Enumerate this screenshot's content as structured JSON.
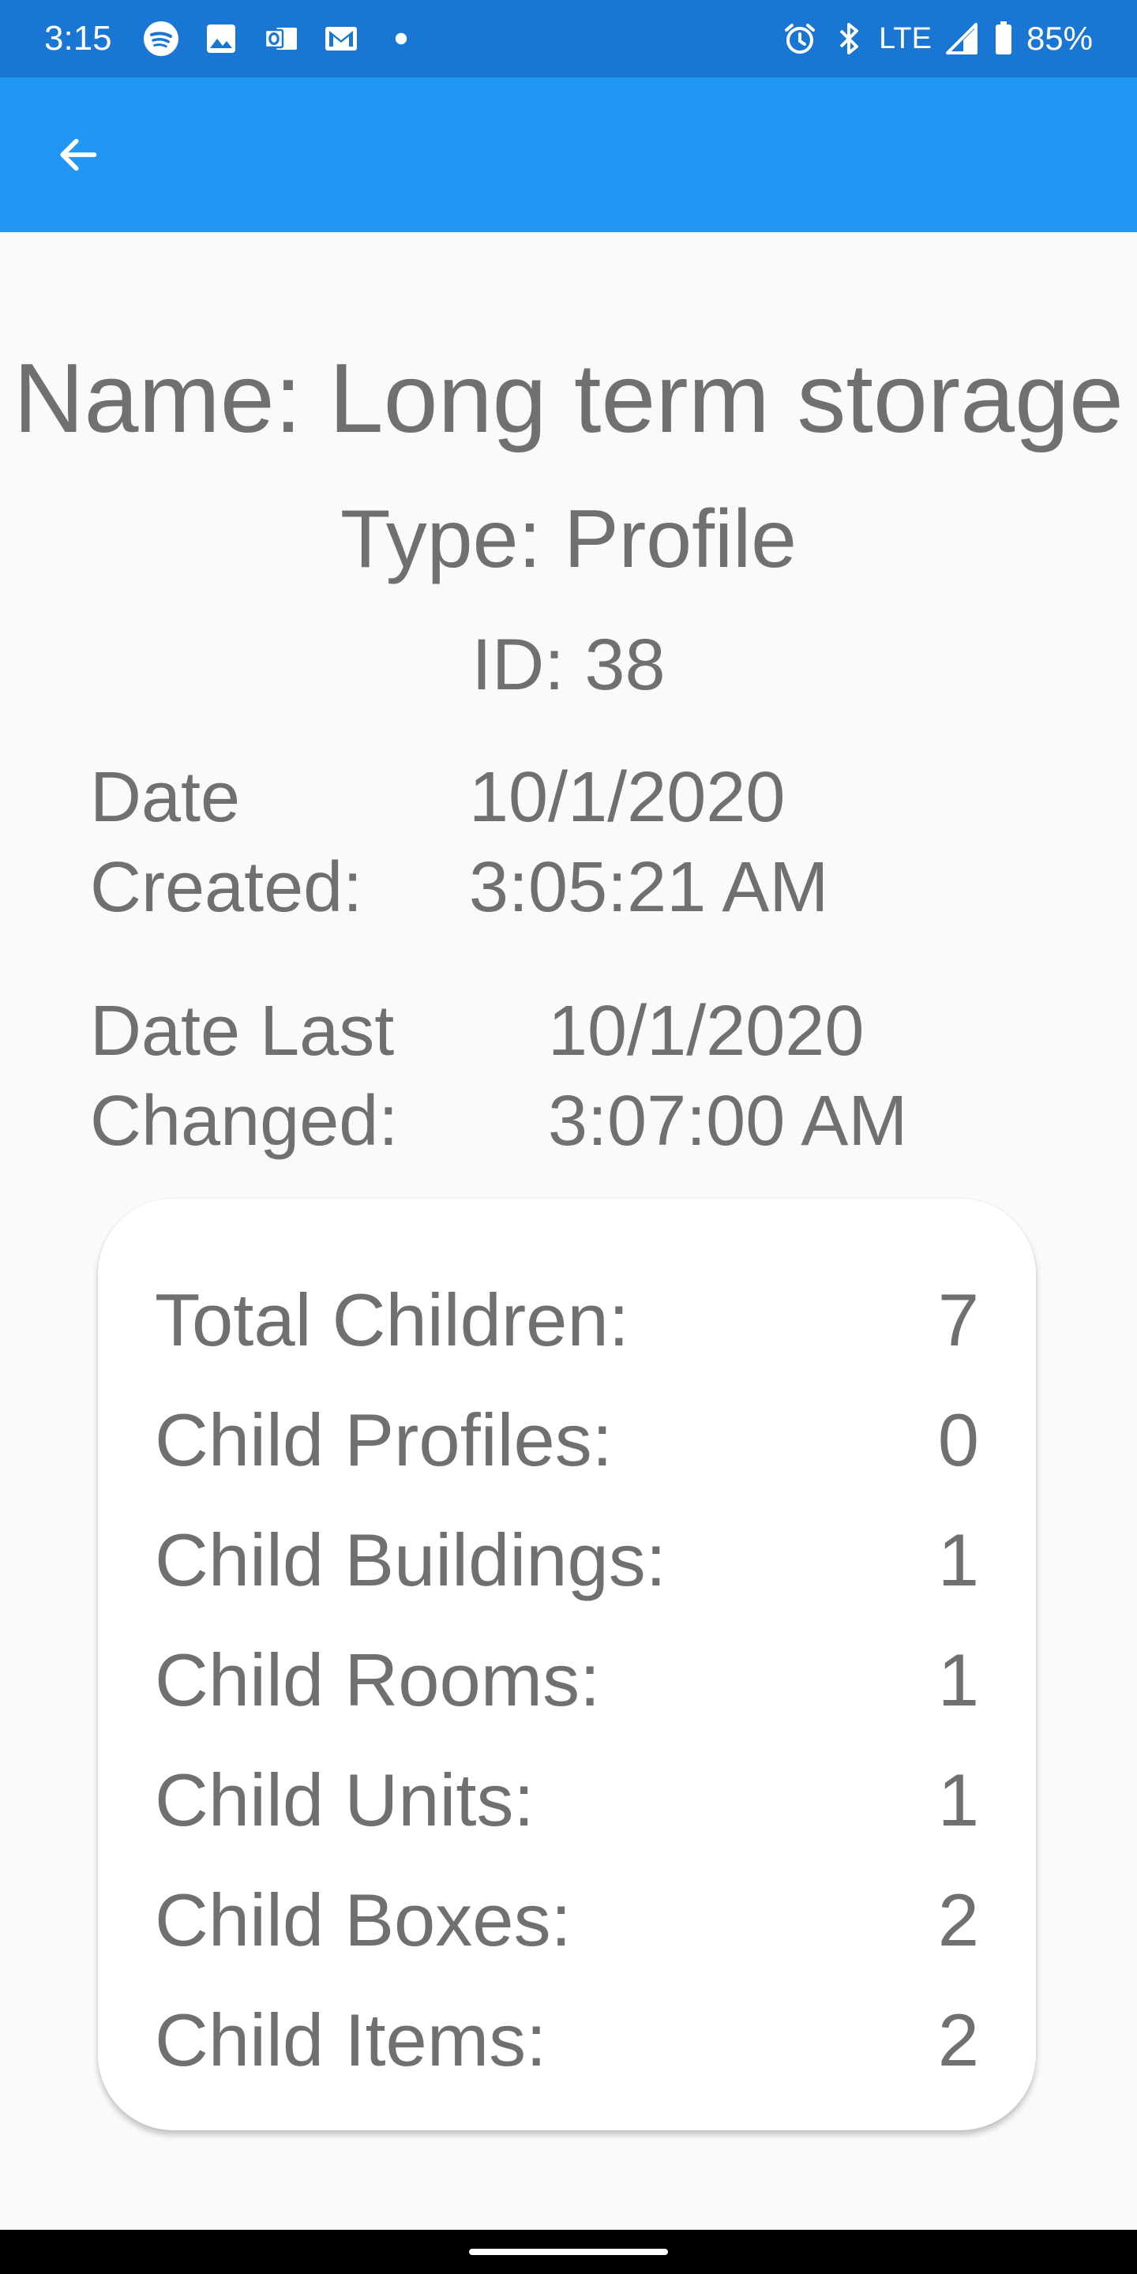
{
  "status_bar": {
    "time": "3:15",
    "left_icons": [
      "spotify-icon",
      "gallery-icon",
      "outlook-icon",
      "gmail-icon",
      "notification-dot-icon"
    ],
    "network": "LTE",
    "battery": "85%",
    "colors": {
      "background": "#1976d2",
      "foreground": "#ffffff"
    }
  },
  "app_bar": {
    "back_icon": "arrow-left-icon",
    "color": "#2196f3"
  },
  "record": {
    "name": "Name: Long term storage",
    "type": "Type: Profile",
    "id": "ID: 38"
  },
  "dates": {
    "created_label_1": "Date",
    "created_label_2": "Created:",
    "created_value_1": "10/1/2020",
    "created_value_2": "3:05:21 AM",
    "changed_label_1": "Date Last",
    "changed_label_2": "Changed:",
    "changed_value_1": "10/1/2020",
    "changed_value_2": "3:07:00 AM"
  },
  "stats": [
    {
      "label": "Total Children:",
      "value": "7"
    },
    {
      "label": "Child Profiles:",
      "value": "0"
    },
    {
      "label": "Child Buildings:",
      "value": "1"
    },
    {
      "label": "Child Rooms:",
      "value": "1"
    },
    {
      "label": "Child Units:",
      "value": "1"
    },
    {
      "label": "Child Boxes:",
      "value": "2"
    },
    {
      "label": "Child Items:",
      "value": "2"
    }
  ],
  "text_color": "#707070",
  "page_background": "#fafafa"
}
